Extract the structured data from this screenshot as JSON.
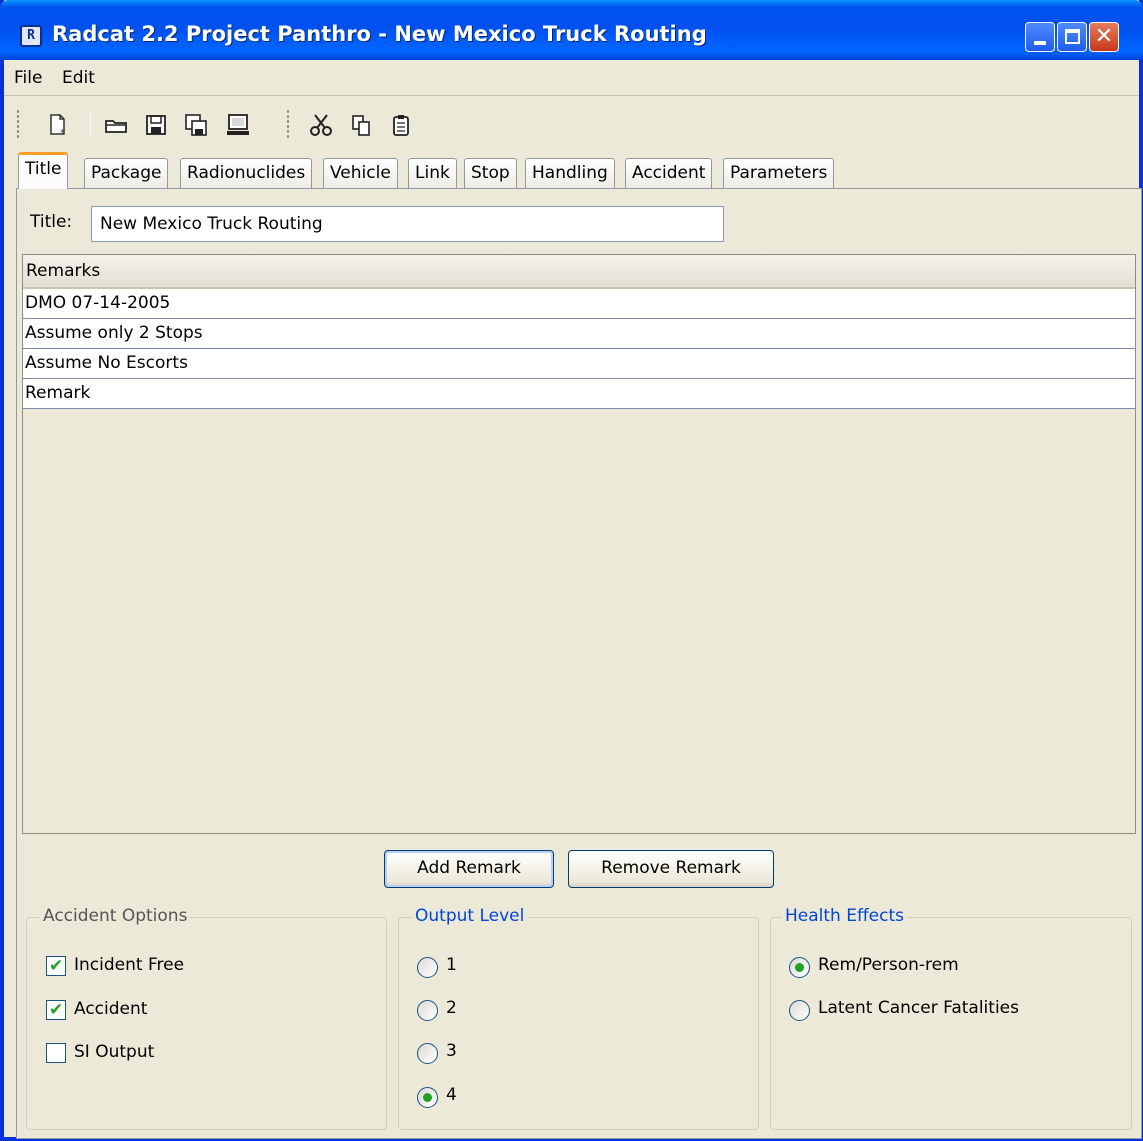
{
  "window": {
    "title": "Radcat 2.2 Project Panthro - New Mexico Truck Routing",
    "app_icon_glyph": "R"
  },
  "menu": {
    "items": [
      "File",
      "Edit"
    ]
  },
  "toolbar": {
    "icons": [
      "new-file-icon",
      "open-folder-icon",
      "save-icon",
      "save-as-icon",
      "run-computer-icon",
      "cut-icon",
      "copy-icon",
      "paste-icon"
    ]
  },
  "tabs": [
    "Title",
    "Package",
    "Radionuclides",
    "Vehicle",
    "Link",
    "Stop",
    "Handling",
    "Accident",
    "Parameters"
  ],
  "active_tab": "Title",
  "title_field": {
    "label": "Title:",
    "value": "New Mexico Truck Routing"
  },
  "remarks": {
    "header": "Remarks",
    "rows": [
      "DMO 07-14-2005",
      "Assume only 2 Stops",
      "Assume No Escorts",
      "Remark"
    ]
  },
  "buttons": {
    "add": "Add Remark",
    "remove": "Remove Remark"
  },
  "accident_options": {
    "title": "Accident Options",
    "items": [
      {
        "label": "Incident Free",
        "checked": true
      },
      {
        "label": "Accident",
        "checked": true
      },
      {
        "label": "SI Output",
        "checked": false
      }
    ]
  },
  "output_level": {
    "title": "Output Level",
    "items": [
      {
        "label": "1",
        "selected": false
      },
      {
        "label": "2",
        "selected": false
      },
      {
        "label": "3",
        "selected": false
      },
      {
        "label": "4",
        "selected": true
      }
    ]
  },
  "health_effects": {
    "title": "Health Effects",
    "items": [
      {
        "label": "Rem/Person-rem",
        "selected": true
      },
      {
        "label": "Latent Cancer Fatalities",
        "selected": false
      }
    ]
  },
  "colors": {
    "titlebar": "#0053ee",
    "accent_tab": "#ff9c2a",
    "check": "#21a121",
    "group_title_blue": "#0046d5"
  }
}
